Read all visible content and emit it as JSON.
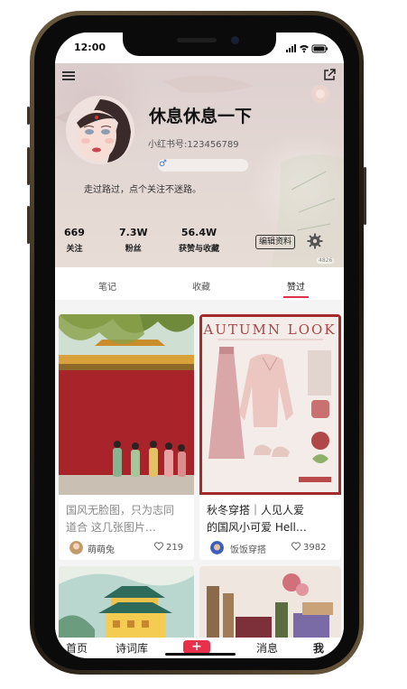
{
  "status_bar": {
    "time": "12:00"
  },
  "profile": {
    "nickname": "休息休息一下",
    "user_id": "小红书号:123456789",
    "gender_symbol": "♂",
    "bio": "走过路过，点个关注不迷路。",
    "stats": [
      {
        "value": "669",
        "label": "关注"
      },
      {
        "value": "7.3W",
        "label": "粉丝"
      },
      {
        "value": "56.4W",
        "label": "获赞与收藏"
      }
    ],
    "edit_label": "编辑资料",
    "tag": "4826"
  },
  "tabs": [
    {
      "label": "笔记",
      "active": false
    },
    {
      "label": "收藏",
      "active": false
    },
    {
      "label": "赞过",
      "active": true
    }
  ],
  "feed": [
    {
      "title_line1": "国风无脸图，只为志同",
      "title_line2": "道合 这几张图片…",
      "user": "萌萌兔",
      "likes": "219"
    },
    {
      "image_text": "AUTUMN LOOK",
      "title_line1": "秋冬穿搭｜人见人爱",
      "title_line2": "的国风小可爱 Hell…",
      "user": "饭饭穿搭",
      "likes": "3982"
    }
  ],
  "bottom_nav": {
    "home": "首页",
    "poetry": "诗词库",
    "plus": "+",
    "messages": "消息",
    "me": "我"
  },
  "colors": {
    "accent": "#e0314b",
    "plus_button": "#e8304a",
    "gender": "#3b7fd0"
  }
}
